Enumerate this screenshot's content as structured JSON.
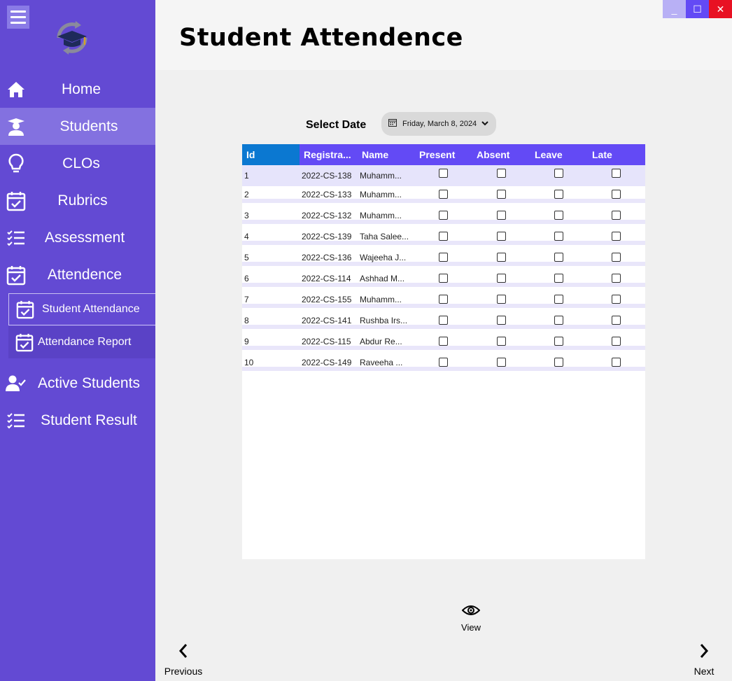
{
  "header": {
    "title": "Student Attendence"
  },
  "window_controls": {
    "minimize": "_",
    "maximize": "☐",
    "close": "✕"
  },
  "sidebar": {
    "items": [
      {
        "label": "Home",
        "icon": "home-icon"
      },
      {
        "label": "Students",
        "icon": "student-icon",
        "active": true
      },
      {
        "label": "CLOs",
        "icon": "lightbulb-icon"
      },
      {
        "label": "Rubrics",
        "icon": "calendar-check-icon"
      },
      {
        "label": "Assessment",
        "icon": "checklist-icon"
      },
      {
        "label": "Attendence",
        "icon": "calendar-check-icon"
      },
      {
        "label": "Active Students",
        "icon": "user-check-icon"
      },
      {
        "label": "Student Result",
        "icon": "checklist-icon"
      }
    ],
    "sub_items": [
      {
        "label": "Student Attendance",
        "icon": "calendar-check-icon",
        "selected": true
      },
      {
        "label": "Attendance Report",
        "icon": "calendar-check-icon"
      }
    ]
  },
  "date_selector": {
    "label": "Select Date",
    "value": "Friday, March 8, 2024"
  },
  "grid": {
    "columns": [
      "Id",
      "Registra...",
      "Name",
      "Present",
      "Absent",
      "Leave",
      "Late"
    ],
    "rows": [
      {
        "id": "1",
        "reg": "2022-CS-138",
        "name": "Muhamm...",
        "present": false,
        "absent": false,
        "leave": false,
        "late": false
      },
      {
        "id": "2",
        "reg": "2022-CS-133",
        "name": "Muhamm...",
        "present": false,
        "absent": false,
        "leave": false,
        "late": false
      },
      {
        "id": "3",
        "reg": "2022-CS-132",
        "name": "Muhamm...",
        "present": false,
        "absent": false,
        "leave": false,
        "late": false
      },
      {
        "id": "4",
        "reg": "2022-CS-139",
        "name": "Taha Salee...",
        "present": false,
        "absent": false,
        "leave": false,
        "late": false
      },
      {
        "id": "5",
        "reg": "2022-CS-136",
        "name": "Wajeeha J...",
        "present": false,
        "absent": false,
        "leave": false,
        "late": false
      },
      {
        "id": "6",
        "reg": "2022-CS-114",
        "name": "Ashhad M...",
        "present": false,
        "absent": false,
        "leave": false,
        "late": false
      },
      {
        "id": "7",
        "reg": "2022-CS-155",
        "name": "Muhamm...",
        "present": false,
        "absent": false,
        "leave": false,
        "late": false
      },
      {
        "id": "8",
        "reg": "2022-CS-141",
        "name": "Rushba Irs...",
        "present": false,
        "absent": false,
        "leave": false,
        "late": false
      },
      {
        "id": "9",
        "reg": "2022-CS-115",
        "name": "Abdur  Re...",
        "present": false,
        "absent": false,
        "leave": false,
        "late": false
      },
      {
        "id": "10",
        "reg": "2022-CS-149",
        "name": "Raveeha ...",
        "present": false,
        "absent": false,
        "leave": false,
        "late": false
      }
    ]
  },
  "actions": {
    "view": "View",
    "previous": "Previous",
    "next": "Next"
  },
  "colors": {
    "sidebar": "#634ad3",
    "sidebar_active": "#8371e0",
    "grid_header": "#634af5",
    "id_header": "#0b78d1"
  }
}
